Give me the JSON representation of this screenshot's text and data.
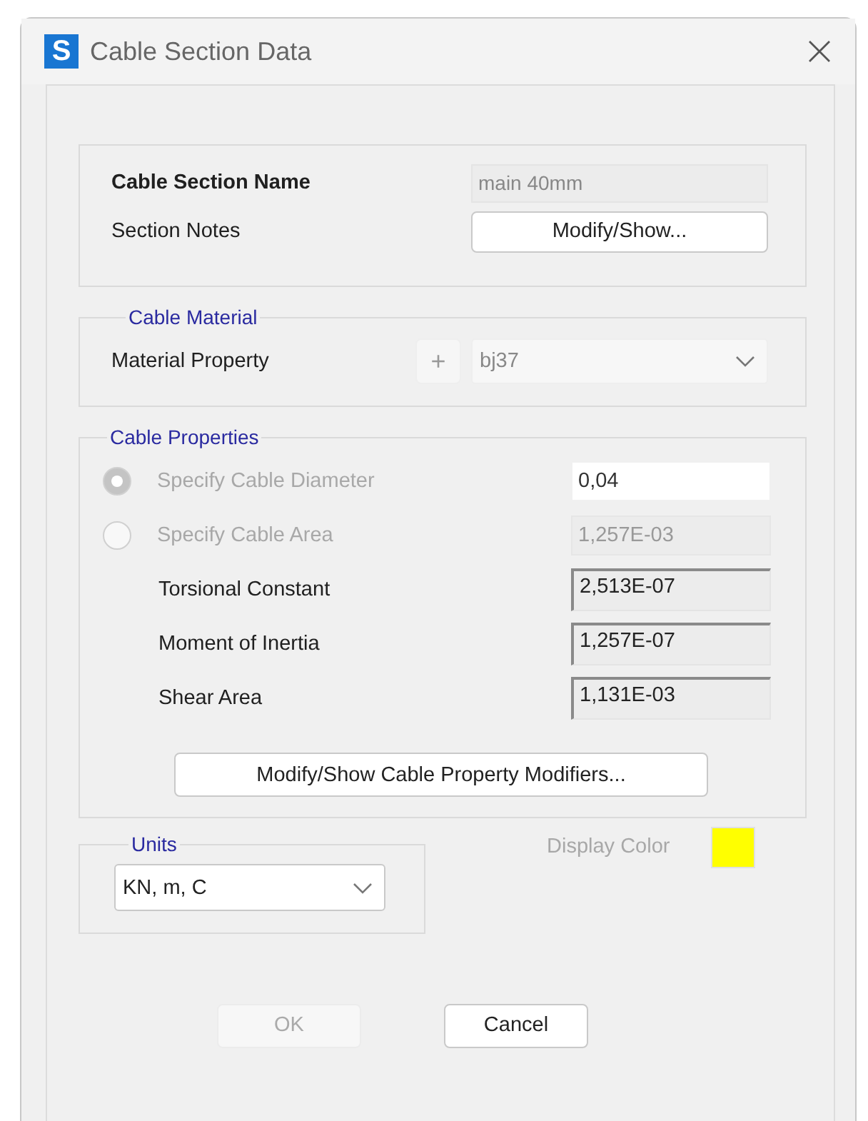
{
  "window": {
    "title": "Cable Section Data",
    "icon_letter": "S"
  },
  "section": {
    "name_label": "Cable Section Name",
    "name_value": "main 40mm",
    "notes_label": "Section Notes",
    "notes_button": "Modify/Show..."
  },
  "cable_material": {
    "legend": "Cable Material",
    "label": "Material Property",
    "add_button": "+",
    "value": "bj37",
    "disabled": true
  },
  "cable_properties": {
    "legend": "Cable Properties",
    "options": [
      {
        "label": "Specify Cable Diameter",
        "selected": true,
        "disabled": true,
        "value": "0,04",
        "editable": true
      },
      {
        "label": "Specify Cable Area",
        "selected": false,
        "disabled": true,
        "value": "1,257E-03",
        "editable": false
      }
    ],
    "properties": [
      {
        "label": "Torsional Constant",
        "value": "2,513E-07"
      },
      {
        "label": "Moment of Inertia",
        "value": "1,257E-07"
      },
      {
        "label": "Shear Area",
        "value": "1,131E-03"
      }
    ],
    "modifiers_button": "Modify/Show Cable Property Modifiers..."
  },
  "units": {
    "legend": "Units",
    "value": "KN, m, C"
  },
  "display_color": {
    "label": "Display Color",
    "color": "#ffff00",
    "disabled": true
  },
  "buttons": [
    {
      "label": "OK",
      "disabled": true
    },
    {
      "label": "Cancel",
      "disabled": false
    }
  ]
}
